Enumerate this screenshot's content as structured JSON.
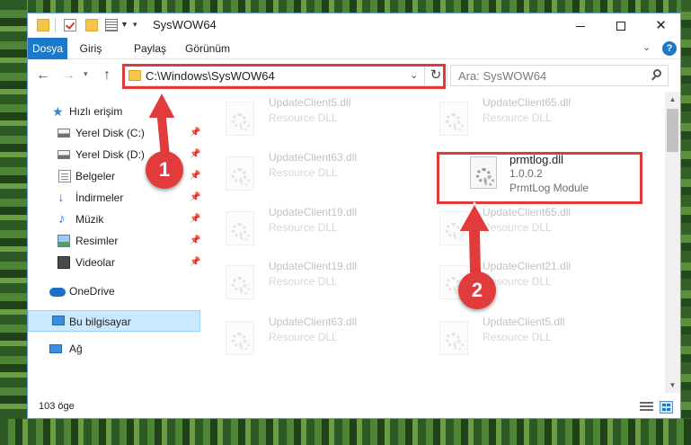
{
  "window": {
    "title": "SysWOW64"
  },
  "ribbon": {
    "tabs": [
      {
        "label": "Dosya"
      },
      {
        "label": "Giriş"
      },
      {
        "label": "Paylaş"
      },
      {
        "label": "Görünüm"
      }
    ]
  },
  "navigation": {
    "address_path": "C:\\Windows\\SysWOW64",
    "search_placeholder": "Ara: SysWOW64"
  },
  "sidebar": {
    "items": [
      {
        "label": "Hızlı erişim",
        "icon": "star-icon",
        "pinned": false
      },
      {
        "label": "Yerel Disk (C:)",
        "icon": "drive-icon",
        "pinned": true
      },
      {
        "label": "Yerel Disk (D:)",
        "icon": "drive-icon",
        "pinned": true
      },
      {
        "label": "Belgeler",
        "icon": "documents-icon",
        "pinned": true
      },
      {
        "label": "İndirmeler",
        "icon": "download-icon",
        "pinned": true
      },
      {
        "label": "Müzik",
        "icon": "music-icon",
        "pinned": true
      },
      {
        "label": "Resimler",
        "icon": "pictures-icon",
        "pinned": true
      },
      {
        "label": "Videolar",
        "icon": "videos-icon",
        "pinned": true
      },
      {
        "label": "OneDrive",
        "icon": "cloud-icon",
        "pinned": false
      },
      {
        "label": "Bu bilgisayar",
        "icon": "computer-icon",
        "pinned": false,
        "selected": true
      },
      {
        "label": "Ağ",
        "icon": "network-icon",
        "pinned": false
      }
    ]
  },
  "files": [
    {
      "name": "UpdateClient5.dll",
      "description": "Resource DLL",
      "faded": true
    },
    {
      "name": "UpdateClient65.dll",
      "description": "Resource DLL",
      "faded": true
    },
    {
      "name": "UpdateClient63.dll",
      "description": "Resource DLL",
      "faded": true
    },
    {
      "name": "prmtlog.dll",
      "version": "1.0.0.2",
      "description": "PrmtLog Module",
      "faded": false,
      "highlighted": true
    },
    {
      "name": "UpdateClient19.dll",
      "description": "Resource DLL",
      "faded": true
    },
    {
      "name": "UpdateClient65.dll",
      "description": "Resource DLL",
      "faded": true
    },
    {
      "name": "UpdateClient19.dll",
      "description": "Resource DLL",
      "faded": true
    },
    {
      "name": "UpdateClient21.dll",
      "description": "Resource DLL",
      "faded": true
    },
    {
      "name": "UpdateClient63.dll",
      "description": "Resource DLL",
      "faded": true
    },
    {
      "name": "UpdateClient5.dll",
      "description": "Resource DLL",
      "faded": true
    }
  ],
  "status": {
    "item_count": "103 öge"
  },
  "annotations": {
    "step1": "1",
    "step2": "2",
    "color": "#e03a3a"
  },
  "colors": {
    "accent": "#1979ca",
    "selection": "#cce8ff"
  }
}
